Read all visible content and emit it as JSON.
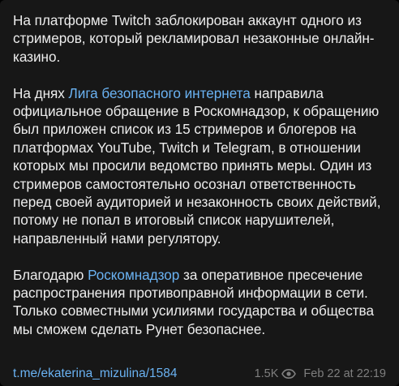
{
  "post": {
    "paragraphs": [
      {
        "before": "На платформе Twitch заблокирован аккаунт одного из стримеров, который рекламировал незаконные онлайн-казино.",
        "link": "",
        "after": ""
      },
      {
        "before": "На днях ",
        "link": "Лига безопасного интернета",
        "after": " направила официальное обращение в Роскомнадзор, к обращению был приложен список из 15 стримеров и блогеров на платформах YouTube, Twitch и Telegram, в отношении которых мы просили ведомство принять меры. Один из стримеров самостоятельно осознал ответственность перед своей аудиторией и незаконность своих действий, потому не попал в итоговый список нарушителей, направленный нами регулятору."
      },
      {
        "before": "Благодарю ",
        "link": "Роскомнадзор",
        "after": " за оперативное пресечение распространения противоправной информации в сети. Только совместными усилиями государства и общества мы сможем сделать Рунет безопаснее."
      }
    ],
    "footer": {
      "post_link": "t.me/ekaterina_mizulina/1584",
      "views": "1.5K",
      "date": "Feb 22 at 22:19"
    }
  },
  "colors": {
    "background": "#171717",
    "text": "#ececec",
    "link": "#6ab2f2",
    "meta": "#7f7f7f"
  },
  "icons": {
    "views": "eye-icon"
  }
}
